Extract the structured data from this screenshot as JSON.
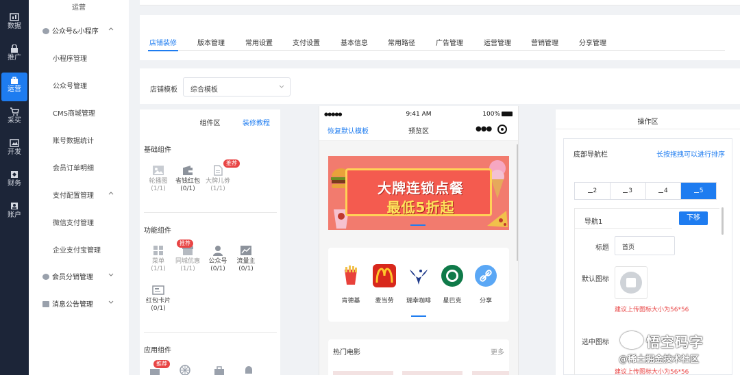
{
  "rail": {
    "items": [
      {
        "label": "数据",
        "icon": "chart-icon"
      },
      {
        "label": "推广",
        "icon": "lock-icon"
      },
      {
        "label": "运营",
        "icon": "bag-icon",
        "active": true
      },
      {
        "label": "采买",
        "icon": "cart-icon"
      },
      {
        "label": "开发",
        "icon": "image-icon"
      },
      {
        "label": "财务",
        "icon": "diamond-icon"
      },
      {
        "label": "账户",
        "icon": "user-icon"
      }
    ]
  },
  "submenu": {
    "top": "运营",
    "groups": [
      {
        "label": "公众号&小程序"
      },
      {
        "label": "会员分销管理"
      },
      {
        "label": "消息公告管理"
      }
    ],
    "items": [
      "小程序管理",
      "公众号管理",
      "CMS商城管理",
      "账号数据统计",
      "会员订单明细",
      "支付配置管理",
      "微信支付管理",
      "企业支付宝管理"
    ]
  },
  "tabs": [
    "店铺装修",
    "版本管理",
    "常用设置",
    "支付设置",
    "基本信息",
    "常用路径",
    "广告管理",
    "运营管理",
    "营销管理",
    "分享管理"
  ],
  "template": {
    "label": "店铺模板",
    "value": "综合模板"
  },
  "components": {
    "title": "组件区",
    "tutorial": "装修教程",
    "badge": "推荐",
    "basic": {
      "title": "基础组件",
      "items": [
        {
          "name": "轮播图",
          "count": "(1/1)"
        },
        {
          "name": "省钱红包",
          "count": "(0/1)"
        },
        {
          "name": "大牌儿券",
          "count": "(1/1)"
        }
      ]
    },
    "func": {
      "title": "功能组件",
      "items": [
        {
          "name": "菜单",
          "count": "(1/1)"
        },
        {
          "name": "同城优惠",
          "count": "(1/1)"
        },
        {
          "name": "公众号",
          "count": "(0/1)"
        },
        {
          "name": "流量主",
          "count": "(0/1)"
        },
        {
          "name": "红包卡片",
          "count": "(0/1)"
        }
      ]
    },
    "app": {
      "title": "应用组件"
    }
  },
  "phone": {
    "signal": "●●●●● ",
    "time": "9:41 AM",
    "battery": "100%",
    "restore": "恢复默认模板",
    "preview": "预览区",
    "dots": "●●●",
    "banner": {
      "line1": "大牌连锁点餐",
      "line2": "最低5折起"
    },
    "brands": [
      {
        "name": "肯德基",
        "color": "#e8413a"
      },
      {
        "name": "麦当劳",
        "color": "#d8281c"
      },
      {
        "name": "瑞幸咖啡",
        "color": "#1f3a8a"
      },
      {
        "name": "星巴克",
        "color": "#0f7a49"
      },
      {
        "name": "分享",
        "color": "#5aa7f5"
      }
    ],
    "movies": {
      "title": "热门电影",
      "more": "更多"
    }
  },
  "ops": {
    "title": "操作区",
    "heading": "底部导航栏",
    "hint": "长按拖拽可以进行排序",
    "segments": [
      "2",
      "3",
      "4",
      "5"
    ],
    "nav": {
      "title": "导航1",
      "move": "下移",
      "title_label": "标题",
      "title_value": "首页",
      "default_icon": "默认图标",
      "selected_icon": "选中图标",
      "warn": "建议上传图标大小为56*56"
    }
  },
  "watermark": {
    "line1": "悟空码字",
    "line2": "@稀土掘金技术社区"
  },
  "colors": {
    "accent": "#1e7cf0",
    "rail": "#1c2538",
    "badge": "#e84545"
  }
}
